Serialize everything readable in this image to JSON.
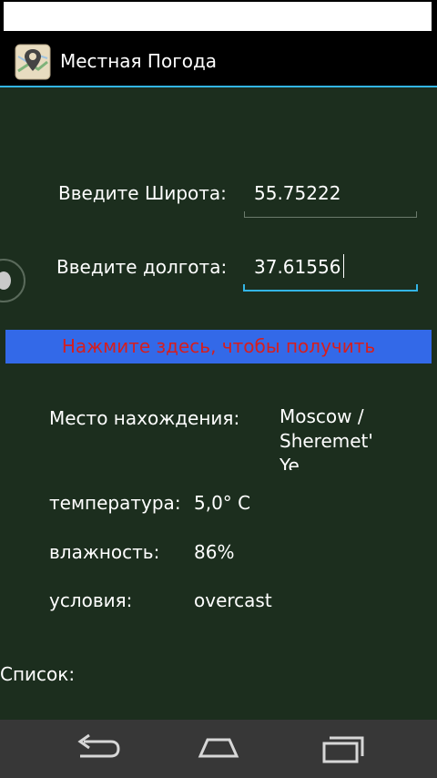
{
  "app": {
    "title": "Местная Погода",
    "icon": "map-pin-icon"
  },
  "form": {
    "latitude_label": "Введите Широта:",
    "latitude_value": "55.75222",
    "longitude_label": "Введите долгота:",
    "longitude_value": "37.61556"
  },
  "fetch_button_label": "Нажмите здесь, чтобы получить",
  "weather": {
    "location_label": "Место нахождения:",
    "location_value": "Moscow / Sheremet' Ye",
    "temperature_label": "температура:",
    "temperature_value": "5,0° C",
    "humidity_label": "влажность:",
    "humidity_value": "86%",
    "conditions_label": "условия:",
    "conditions_value": "overcast"
  },
  "list_label": "Список:",
  "colors": {
    "background": "#1c2e1e",
    "accent": "#33b5e5",
    "button_bg": "#3369e8",
    "button_text": "#d61e1e"
  },
  "nav": [
    "back-icon",
    "home-icon",
    "recent-apps-icon"
  ]
}
